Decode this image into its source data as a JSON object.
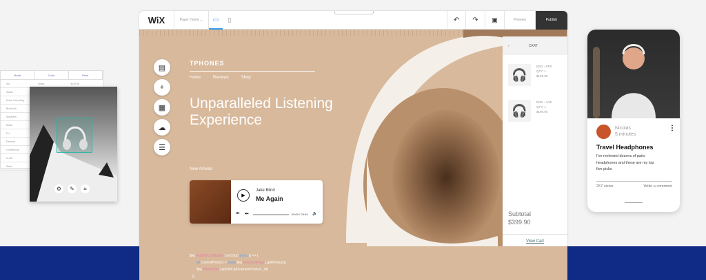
{
  "table": {
    "headers": [
      "Mode",
      "Color",
      "Price"
    ],
    "rows": [
      [
        "Ski",
        "Black",
        "$129.95"
      ],
      [
        "Studio",
        "",
        ""
      ],
      [
        "Noise Cancelling",
        "",
        ""
      ],
      [
        "Bluetooth",
        "",
        ""
      ],
      [
        "Speakers",
        "",
        ""
      ],
      [
        "Music",
        "",
        ""
      ],
      [
        "Pro",
        "",
        ""
      ],
      [
        "Earbuds",
        "",
        ""
      ],
      [
        "Commercial",
        "",
        ""
      ],
      [
        "In-Ear",
        "",
        ""
      ],
      [
        "Static",
        "",
        ""
      ]
    ]
  },
  "editor": {
    "logo": "WiX",
    "page_selector": "Page: Home",
    "preview": "Preview",
    "publish": "Publish"
  },
  "site": {
    "brand": "TPHONES",
    "nav": [
      "Home",
      "Reviews",
      "Shop"
    ],
    "headline": "Unparalleled Listening Experience",
    "new_arrivals": "New Arrivals",
    "player": {
      "artist": "Jake Blind",
      "title": "Me Again",
      "time": "00:00 / 03:04",
      "progress": 0
    }
  },
  "cart": {
    "title": "CART",
    "items": [
      {
        "name": "END - PRO",
        "qty": "QTY: 1",
        "price": "$199.95"
      },
      {
        "name": "END - ACE",
        "qty": "QTY: 1",
        "price": "$199.95"
      }
    ],
    "subtotal_label": "Subtotal",
    "subtotal": "$399.90",
    "view_cart": "View Cart"
  },
  "code": {
    "l1a": "$w(",
    "l1b": "'#addToCartButton'",
    "l1c": ").onClick(",
    "l1d": "async",
    "l1e": " () => {",
    "l2a": "let",
    "l2b": " currentProduct = ",
    "l2c": "await",
    "l2d": " $w(",
    "l2e": "'#productPage'",
    "l2f": ").getProduct()",
    "l3a": "$w(",
    "l3b": "'#storeCart'",
    "l3c": ").addToCart(currentProduct._id)",
    "l4": "})"
  },
  "blog": {
    "author": "Nicolas",
    "time": "5 minutes",
    "title": "Travel Headphones",
    "body": "I've reviewed dozens of pairs headphones and these are my top five picks",
    "views": "257 views",
    "comment": "Write a comment"
  }
}
